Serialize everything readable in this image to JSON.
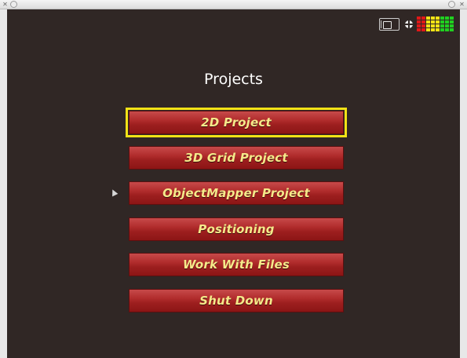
{
  "window": {
    "close_glyph": "✕",
    "icons": [
      "close-icon",
      "circle-icon",
      "minimize-icon",
      "close-icon"
    ]
  },
  "status": {
    "icons": [
      "scanner-icon",
      "globe-icon",
      "signal-meter-icon"
    ],
    "meter_colors": {
      "red": "#e01818",
      "yellow": "#f2e216",
      "green": "#20d020"
    }
  },
  "main": {
    "title": "Projects",
    "menu": [
      {
        "label": "2D Project",
        "selected": true
      },
      {
        "label": "3D Grid Project"
      },
      {
        "label": "ObjectMapper Project"
      },
      {
        "label": "Positioning"
      },
      {
        "label": "Work With Files"
      },
      {
        "label": "Shut Down"
      }
    ]
  },
  "colors": {
    "screen_bg": "#302725",
    "button_text": "#f6e98a",
    "selection": "#f2e216"
  }
}
